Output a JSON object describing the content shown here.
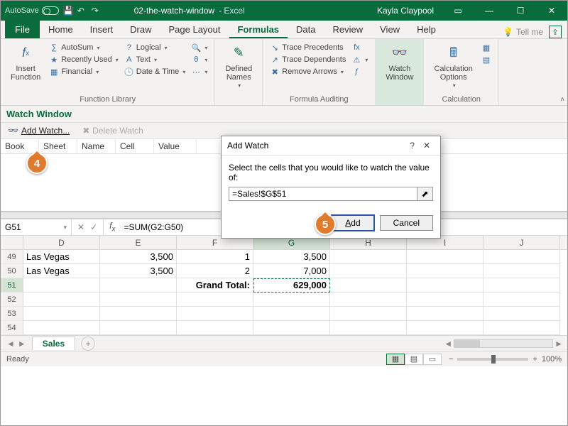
{
  "title": {
    "autosave": "AutoSave",
    "doc": "02-the-watch-window",
    "app": "- Excel",
    "user": "Kayla Claypool"
  },
  "tabs": {
    "file": "File",
    "home": "Home",
    "insert": "Insert",
    "draw": "Draw",
    "pagelayout": "Page Layout",
    "formulas": "Formulas",
    "data": "Data",
    "review": "Review",
    "view": "View",
    "help": "Help",
    "tellme": "Tell me"
  },
  "ribbon": {
    "insertfn": "Insert\nFunction",
    "autosum": "AutoSum",
    "recent": "Recently Used",
    "financial": "Financial",
    "logical": "Logical",
    "text": "Text",
    "datetime": "Date & Time",
    "lookup": "",
    "mathtrig": "",
    "more": "",
    "defnames": "Defined\nNames",
    "traceprec": "Trace Precedents",
    "tracedep": "Trace Dependents",
    "removearr": "Remove Arrows",
    "watch": "Watch\nWindow",
    "calcopt": "Calculation\nOptions",
    "g1": "Function Library",
    "g2": "Formula Auditing",
    "g3": "Calculation"
  },
  "watch": {
    "title": "Watch Window",
    "add": "Add Watch...",
    "del": "Delete Watch",
    "cols": {
      "book": "Book",
      "sheet": "Sheet",
      "name": "Name",
      "cell": "Cell",
      "value": "Value"
    }
  },
  "fx": {
    "name": "G51",
    "formula": "=SUM(G2:G50)"
  },
  "cols": [
    "D",
    "E",
    "F",
    "G",
    "H",
    "I",
    "J"
  ],
  "rows": [
    {
      "n": "49",
      "d": "Las Vegas",
      "e": "3,500",
      "f": "1",
      "g": "3,500"
    },
    {
      "n": "50",
      "d": "Las Vegas",
      "e": "3,500",
      "f": "2",
      "g": "7,000"
    },
    {
      "n": "51",
      "d": "",
      "e": "",
      "f": "Grand Total:",
      "g": "629,000",
      "bold": true,
      "sel": true
    },
    {
      "n": "52"
    },
    {
      "n": "53"
    },
    {
      "n": "54"
    }
  ],
  "sheet": {
    "name": "Sales"
  },
  "status": {
    "ready": "Ready",
    "zoom": "100%"
  },
  "dialog": {
    "title": "Add Watch",
    "msg": "Select the cells that you would like to watch the value of:",
    "value": "=Sales!$G$51",
    "add": "Add",
    "cancel": "Cancel",
    "help": "?",
    "close": "✕"
  },
  "callouts": {
    "c4": "4",
    "c5": "5"
  }
}
